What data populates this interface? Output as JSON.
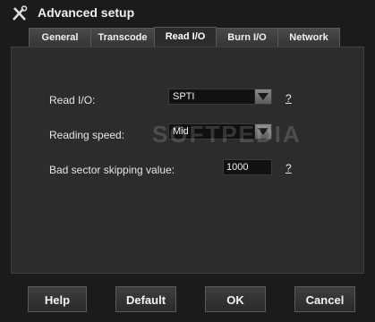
{
  "window": {
    "title": "Advanced setup"
  },
  "tabs": [
    {
      "label": "General",
      "active": false
    },
    {
      "label": "Transcode",
      "active": false
    },
    {
      "label": "Read I/O",
      "active": true
    },
    {
      "label": "Burn I/O",
      "active": false
    },
    {
      "label": "Network",
      "active": false
    }
  ],
  "form": {
    "read_io": {
      "label": "Read I/O:",
      "value": "SPTI",
      "help": "?"
    },
    "reading_speed": {
      "label": "Reading speed:",
      "value": "Mid"
    },
    "bad_sector": {
      "label": "Bad sector skipping value:",
      "value": "1000",
      "help": "?"
    }
  },
  "watermark": "SOFTPEDIA",
  "buttons": {
    "help": "Help",
    "default": "Default",
    "ok": "OK",
    "cancel": "Cancel"
  }
}
